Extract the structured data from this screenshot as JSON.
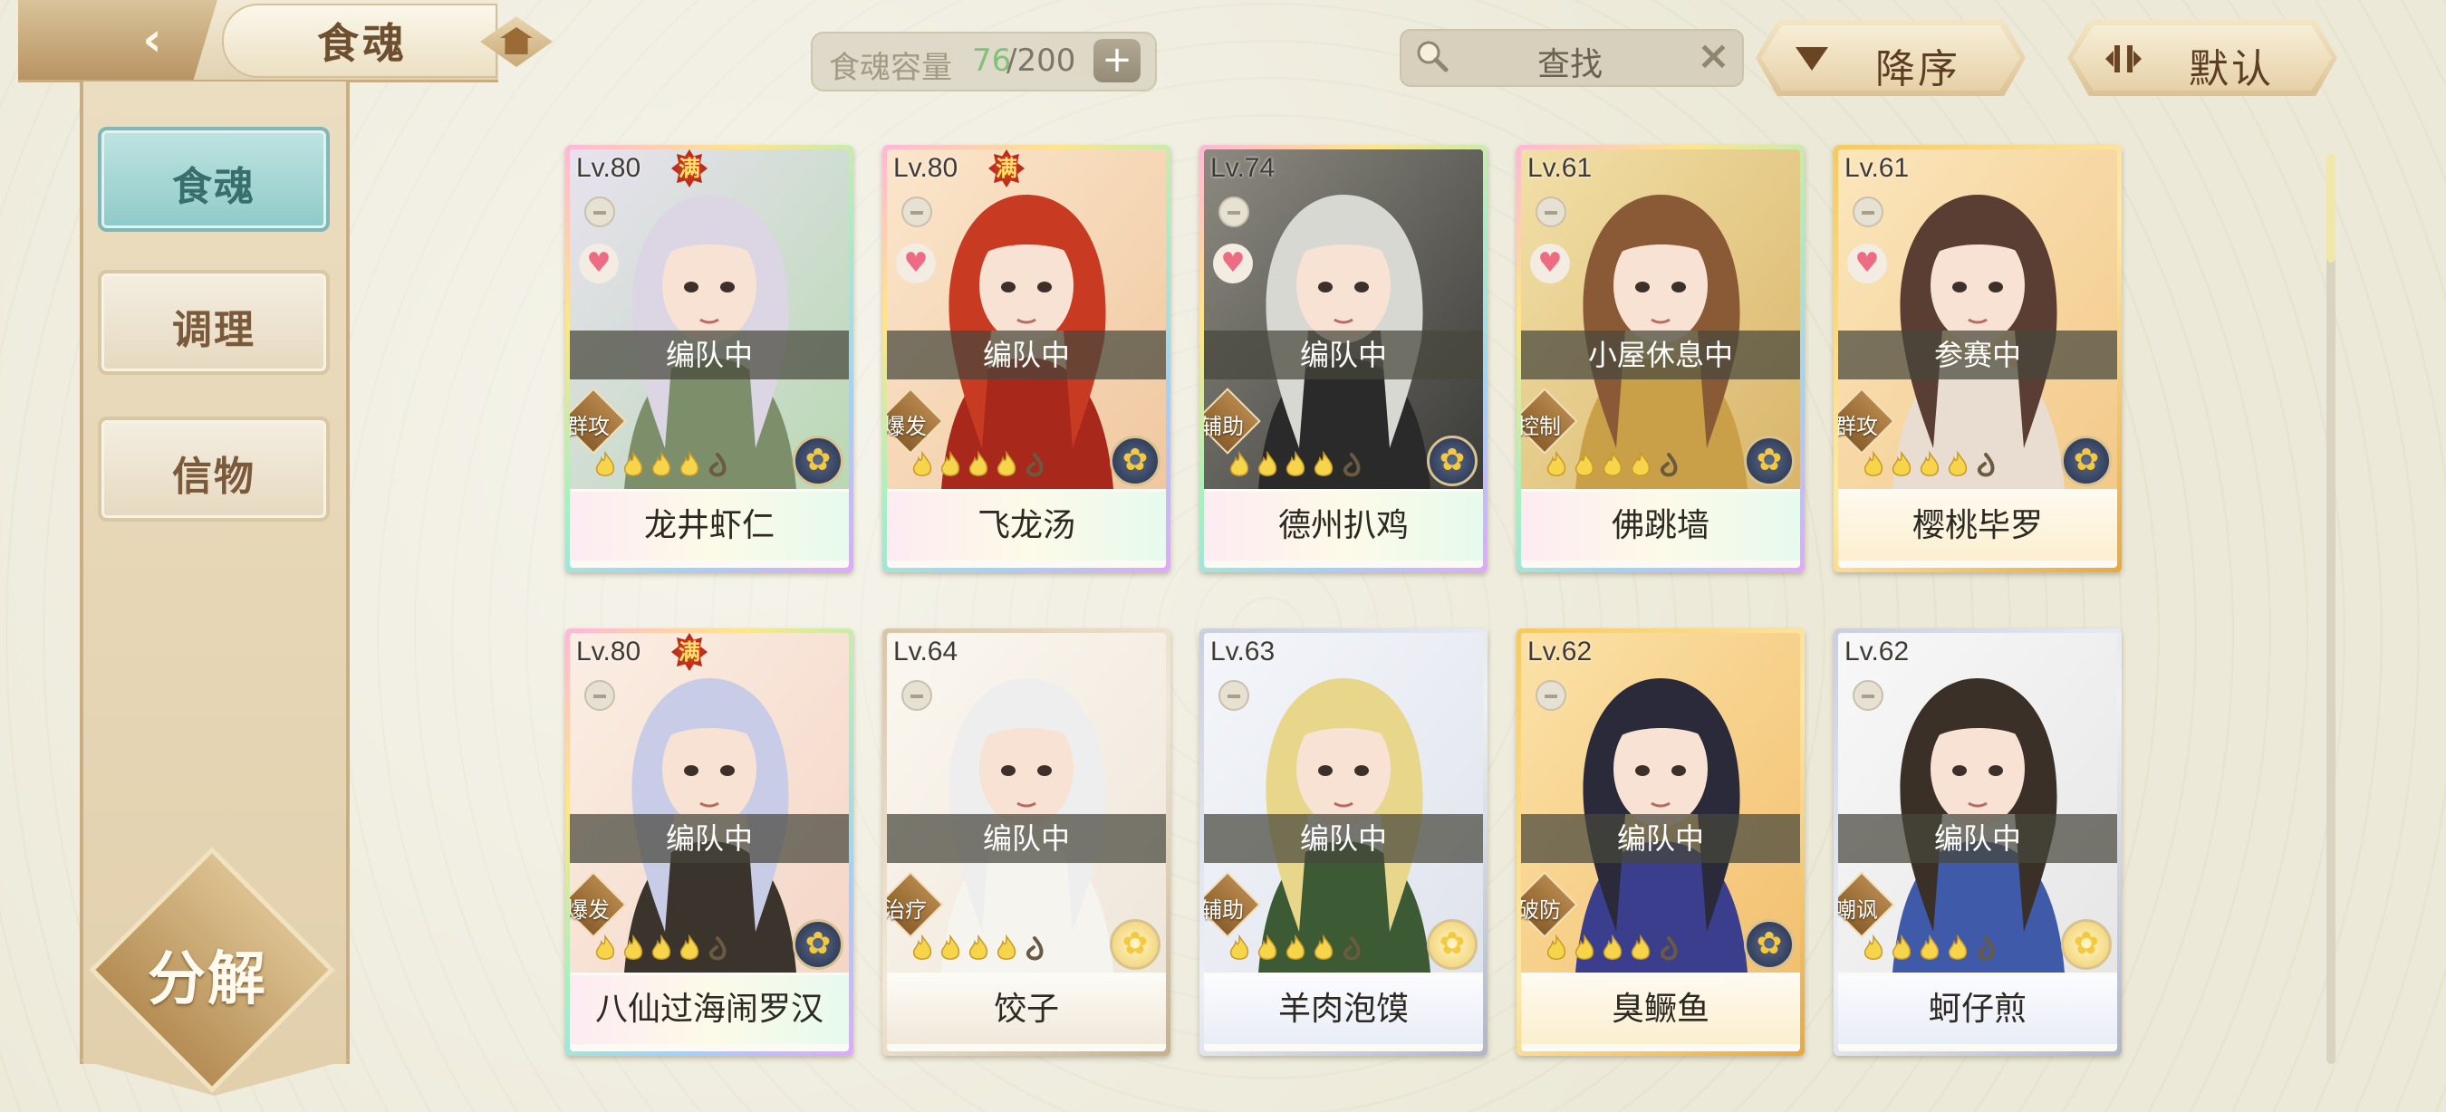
{
  "header": {
    "title": "食魂",
    "capacity_label": "食魂容量",
    "capacity_current": "76",
    "capacity_total": "/200",
    "search_placeholder": "查找",
    "sort_order_label": "降序",
    "sort_mode_label": "默认"
  },
  "sidebar": {
    "items": [
      {
        "label": "食魂",
        "active": true
      },
      {
        "label": "调理",
        "active": false
      },
      {
        "label": "信物",
        "active": false
      }
    ],
    "decompose_label": "分解"
  },
  "cards": [
    {
      "level": "Lv.80",
      "full": "满",
      "status": "编队中",
      "role": "群攻",
      "name": "龙井虾仁",
      "frame": "rainbow",
      "element": "dark",
      "heart": true,
      "portrait": {
        "hair": "#dcd6e4",
        "bg1": "#b9d8b4",
        "bg2": "#e8e2f0",
        "cloth": "#7d8f6a"
      }
    },
    {
      "level": "Lv.80",
      "full": "满",
      "status": "编队中",
      "role": "爆发",
      "name": "飞龙汤",
      "frame": "rainbow",
      "element": "dark",
      "heart": true,
      "portrait": {
        "hair": "#c93a22",
        "bg1": "#f0c8a0",
        "bg2": "#fbe6cc",
        "cloth": "#a8281c"
      }
    },
    {
      "level": "Lv.74",
      "full": "",
      "status": "编队中",
      "role": "辅助",
      "name": "德州扒鸡",
      "frame": "rainbow",
      "element": "dark",
      "heart": true,
      "portrait": {
        "hair": "#d8d8d2",
        "bg1": "#3a3a38",
        "bg2": "#8c8a80",
        "cloth": "#2a2a2a"
      }
    },
    {
      "level": "Lv.61",
      "full": "",
      "status": "小屋休息中",
      "role": "控制",
      "name": "佛跳墙",
      "frame": "rainbow",
      "element": "dark",
      "heart": true,
      "portrait": {
        "hair": "#8a5a36",
        "bg1": "#d9b56a",
        "bg2": "#f2e0a8",
        "cloth": "#c9a048"
      }
    },
    {
      "level": "Lv.61",
      "full": "",
      "status": "参赛中",
      "role": "群攻",
      "name": "樱桃毕罗",
      "frame": "gold",
      "element": "dark",
      "heart": true,
      "portrait": {
        "hair": "#5a3e34",
        "bg1": "#f3c98a",
        "bg2": "#fbe6bc",
        "cloth": "#e8ddd0"
      }
    },
    {
      "level": "Lv.80",
      "full": "满",
      "status": "编队中",
      "role": "爆发",
      "name": "八仙过海闹罗汉",
      "frame": "rainbow",
      "element": "dark",
      "heart": false,
      "portrait": {
        "hair": "#c8cce6",
        "bg1": "#f4d6c6",
        "bg2": "#fbeee4",
        "cloth": "#3a342c"
      }
    },
    {
      "level": "Lv.64",
      "full": "",
      "status": "编队中",
      "role": "治疗",
      "name": "饺子",
      "frame": "bronze",
      "element": "light",
      "heart": false,
      "portrait": {
        "hair": "#eeeeee",
        "bg1": "#efe6da",
        "bg2": "#fbf7f0",
        "cloth": "#f6f4ee"
      }
    },
    {
      "level": "Lv.63",
      "full": "",
      "status": "编队中",
      "role": "辅助",
      "name": "羊肉泡馍",
      "frame": "silver",
      "element": "light",
      "heart": false,
      "portrait": {
        "hair": "#e8d68a",
        "bg1": "#dfe3ec",
        "bg2": "#f4f6fa",
        "cloth": "#3c5a34"
      }
    },
    {
      "level": "Lv.62",
      "full": "",
      "status": "编队中",
      "role": "破防",
      "name": "臭鳜鱼",
      "frame": "gold",
      "element": "dark",
      "heart": false,
      "portrait": {
        "hair": "#2a2a3a",
        "bg1": "#f3c070",
        "bg2": "#fbe2a8",
        "cloth": "#3a3e8c"
      }
    },
    {
      "level": "Lv.62",
      "full": "",
      "status": "编队中",
      "role": "嘲讽",
      "name": "蚵仔煎",
      "frame": "silver",
      "element": "light",
      "heart": false,
      "portrait": {
        "hair": "#3a3028",
        "bg1": "#e6e6e6",
        "bg2": "#f8f8f8",
        "cloth": "#3e5aa8"
      }
    }
  ]
}
